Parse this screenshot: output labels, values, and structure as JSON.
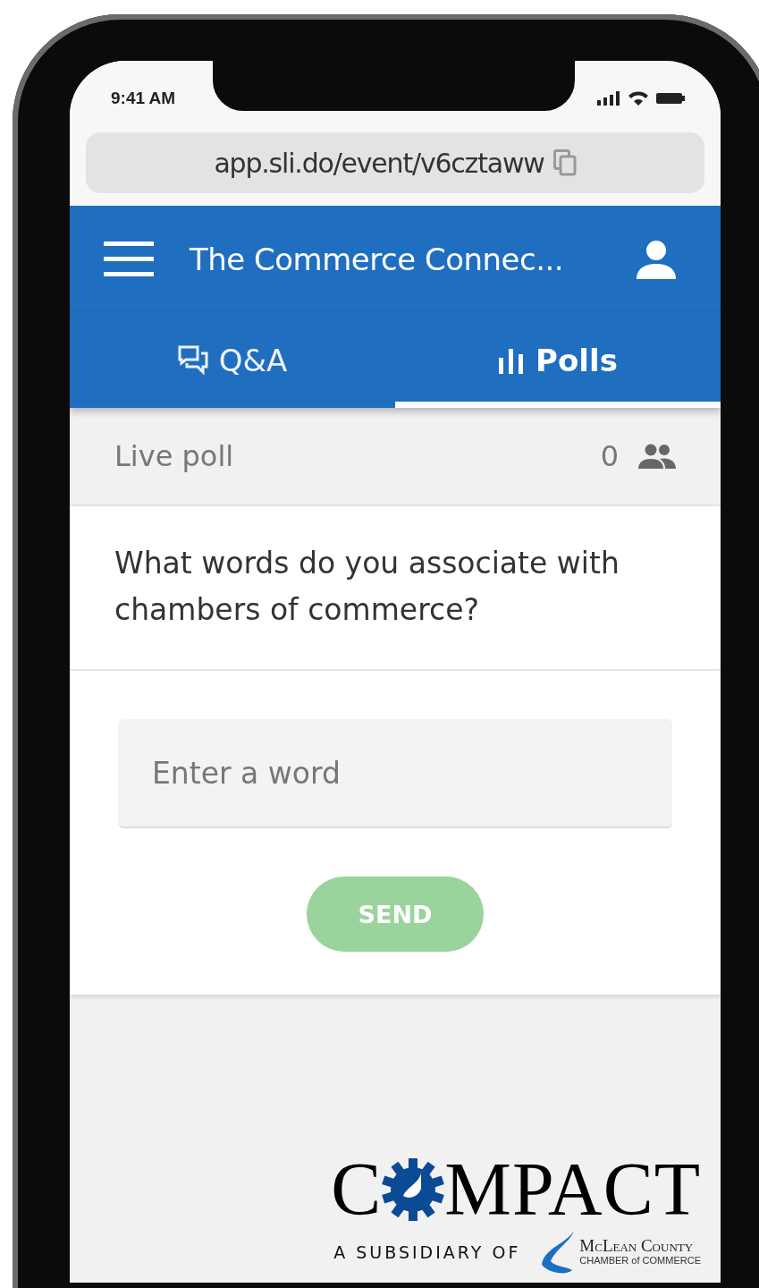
{
  "status_bar": {
    "time": "9:41 AM"
  },
  "address_bar": {
    "url": "app.sli.do/event/v6cztaww"
  },
  "header": {
    "title": "The Commerce Connec..."
  },
  "tabs": [
    {
      "label": "Q&A",
      "kind": "qa",
      "selected": false
    },
    {
      "label": "Polls",
      "kind": "polls",
      "selected": true
    }
  ],
  "poll": {
    "label": "Live poll",
    "participants": "0",
    "question": "What words do you associate with chambers of commerce?",
    "input": {
      "placeholder": "Enter a word"
    },
    "send": {
      "label": "SEND",
      "disabled": true
    }
  },
  "logo": {
    "before": "C",
    "after": "MPACT",
    "tagline": "A SUBSIDIARY OF",
    "partner_line1": "McLean County",
    "partner_line2": "CHAMBER of COMMERCE"
  }
}
